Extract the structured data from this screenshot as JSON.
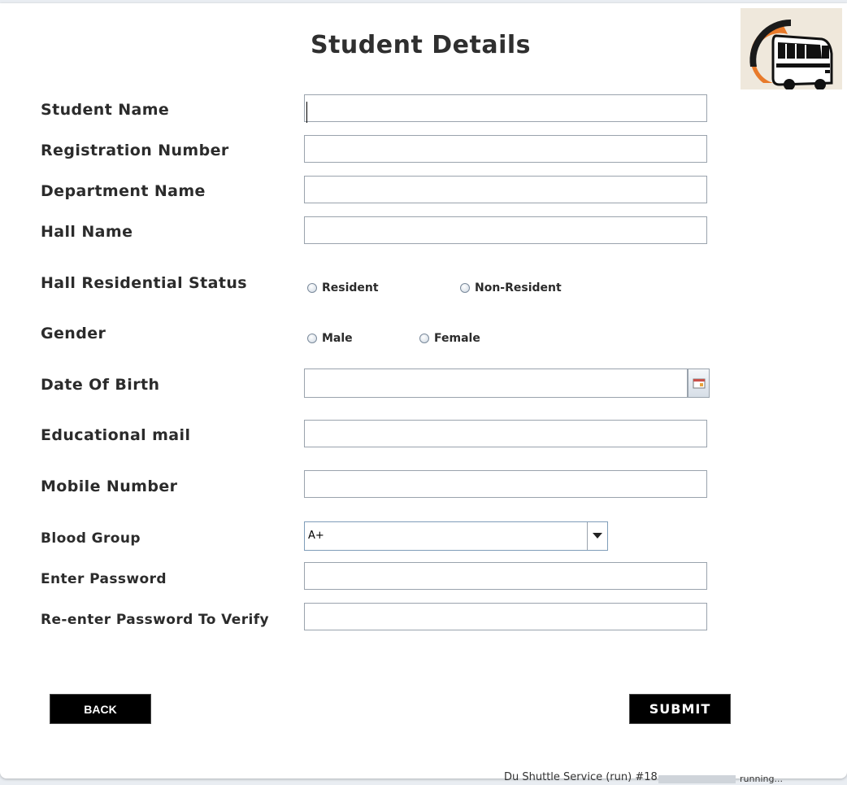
{
  "form": {
    "title": "Student Details",
    "labels": {
      "student_name": "Student Name",
      "registration_number": "Registration Number",
      "department_name": "Department Name",
      "hall_name": "Hall Name",
      "hall_residential_status": "Hall Residential Status",
      "gender": "Gender",
      "date_of_birth": "Date Of Birth",
      "educational_mail": "Educational mail",
      "mobile_number": "Mobile Number",
      "blood_group": "Blood Group",
      "enter_password": "Enter Password",
      "reenter_password": "Re-enter Password To Verify"
    },
    "values": {
      "student_name": "",
      "registration_number": "",
      "department_name": "",
      "hall_name": "",
      "date_of_birth": "",
      "educational_mail": "",
      "mobile_number": "",
      "enter_password": "",
      "reenter_password": ""
    },
    "residential_options": [
      "Resident",
      "Non-Resident"
    ],
    "gender_options": [
      "Male",
      "Female"
    ],
    "blood_group_selected": "A+",
    "back_label": "BACK",
    "submit_label": "SUBMIT"
  },
  "icons": {
    "logo": "bus-logo-icon",
    "calendar": "calendar-icon",
    "dropdown": "chevron-down-icon"
  },
  "colors": {
    "button_bg": "#000000",
    "label_text": "#2b2b2b",
    "logo_orange": "#e87a2b"
  },
  "taskbar": {
    "task": "Du Shuttle Service (run) #18",
    "status": "running..."
  }
}
